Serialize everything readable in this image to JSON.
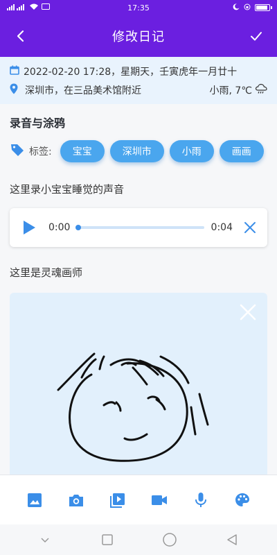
{
  "status": {
    "time": "17:35",
    "signal": "all",
    "battery_level": 0.8
  },
  "appbar": {
    "title": "修改日记",
    "back_icon": "arrow-back-icon",
    "save_icon": "check-icon"
  },
  "info": {
    "datetime": "2022-02-20 17:28，星期天，壬寅虎年一月廿十",
    "location": "深圳市，在三品美术馆附近",
    "weather": "小雨, 7℃"
  },
  "section_title": "录音与涂鸦",
  "tags": {
    "label": "标签:",
    "items": [
      "宝宝",
      "深圳市",
      "小雨",
      "画画"
    ]
  },
  "note1": "这里录小宝宝睡觉的声音",
  "audio": {
    "current": "0:00",
    "duration": "0:04",
    "progress": 0.0
  },
  "note2": "这里是灵魂画师",
  "colors": {
    "primary": "#6b1fe0",
    "accent": "#3b8ee8",
    "tag": "#4aa6ee",
    "info_bg": "#e9f3fd"
  },
  "toolbar": [
    "image-icon",
    "camera-icon",
    "video-library-icon",
    "videocam-icon",
    "mic-icon",
    "palette-icon"
  ],
  "navbar": [
    "collapse-icon",
    "recent-apps-icon",
    "home-icon",
    "back-icon"
  ]
}
